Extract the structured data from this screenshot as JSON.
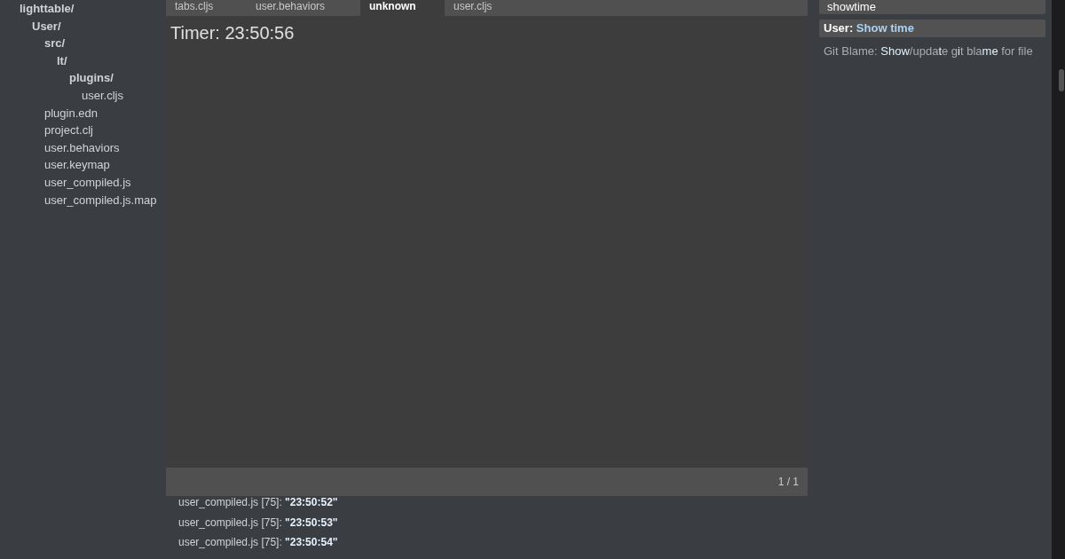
{
  "sidebar": {
    "tree": [
      {
        "name": "lighttable/",
        "folder": true,
        "children": [
          {
            "name": "User/",
            "folder": true,
            "children": [
              {
                "name": "src/",
                "folder": true,
                "children": [
                  {
                    "name": "lt/",
                    "folder": true,
                    "children": [
                      {
                        "name": "plugins/",
                        "folder": true,
                        "children": [
                          {
                            "name": "user.cljs",
                            "folder": false
                          }
                        ]
                      }
                    ]
                  }
                ]
              },
              {
                "name": "plugin.edn",
                "folder": false
              },
              {
                "name": "project.clj",
                "folder": false
              },
              {
                "name": "user.behaviors",
                "folder": false
              },
              {
                "name": "user.keymap",
                "folder": false
              },
              {
                "name": "user_compiled.js",
                "folder": false
              },
              {
                "name": "user_compiled.js.map",
                "folder": false
              }
            ]
          }
        ]
      }
    ]
  },
  "tabs": [
    {
      "label": "tabs.cljs",
      "selected": false
    },
    {
      "label": "user.behaviors",
      "selected": false
    },
    {
      "label": "unknown",
      "selected": true
    },
    {
      "label": "user.cljs",
      "selected": false
    }
  ],
  "editor": {
    "content": "Timer: 23:50:56",
    "status": "1 / 1"
  },
  "console": [
    {
      "source": "user_compiled.js [75]:",
      "value": "\"23:50:52\""
    },
    {
      "source": "user_compiled.js [75]:",
      "value": "\"23:50:53\""
    },
    {
      "source": "user_compiled.js [75]:",
      "value": "\"23:50:54\""
    }
  ],
  "command_panel": {
    "search": {
      "value": "showtime"
    },
    "results": [
      {
        "selected": true,
        "segments": [
          {
            "text": "User: ",
            "match": false
          },
          {
            "text": "Show time",
            "match": true
          }
        ]
      },
      {
        "selected": false,
        "segments": [
          {
            "text": "Git Blame: ",
            "match": false
          },
          {
            "text": "Show",
            "match": true
          },
          {
            "text": "/upda",
            "match": false
          },
          {
            "text": "t",
            "match": true
          },
          {
            "text": "e g",
            "match": false
          },
          {
            "text": "i",
            "match": true
          },
          {
            "text": "t bla",
            "match": false
          },
          {
            "text": "me",
            "match": true
          },
          {
            "text": " for file",
            "match": false
          }
        ]
      }
    ]
  }
}
